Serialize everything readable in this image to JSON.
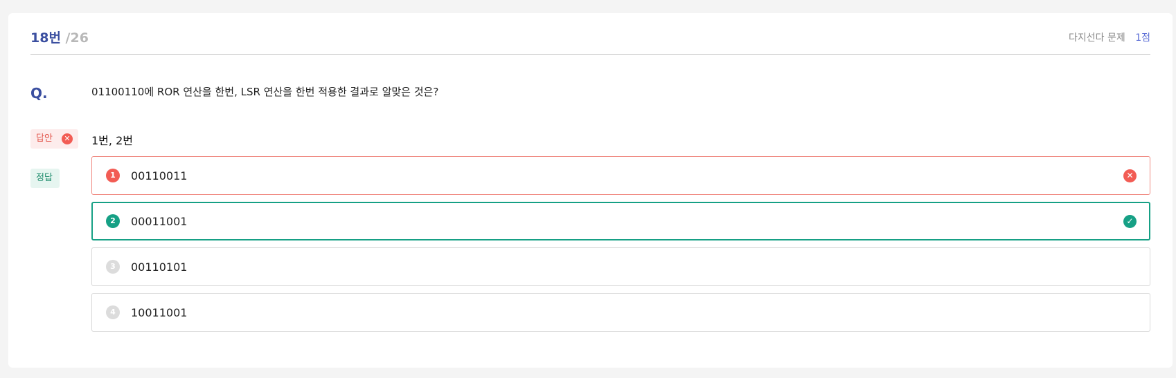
{
  "header": {
    "number": "18번",
    "total": "/26",
    "type_label": "다지선다 문제",
    "points": "1점"
  },
  "question": {
    "label": "Q.",
    "text": "01100110에 ROR 연산을 한번, LSR 연산을 한번 적용한 결과로 알맞은 것은?"
  },
  "submitted": {
    "badge_label": "답안",
    "status_icon": "x-circle-icon",
    "value": "1번, 2번"
  },
  "correct": {
    "badge_label": "정답"
  },
  "options": [
    {
      "num": "1",
      "text": "00110011",
      "state": "wrong",
      "status_icon": "x-circle-icon"
    },
    {
      "num": "2",
      "text": "00011001",
      "state": "right",
      "status_icon": "check-circle-icon"
    },
    {
      "num": "3",
      "text": "00110101",
      "state": "neutral"
    },
    {
      "num": "4",
      "text": "10011001",
      "state": "neutral"
    }
  ],
  "colors": {
    "accent": "#3b4fa0",
    "points": "#5d6fd6",
    "wrong": "#f25c54",
    "correct": "#16a085",
    "neutral": "#dcdcdc"
  }
}
